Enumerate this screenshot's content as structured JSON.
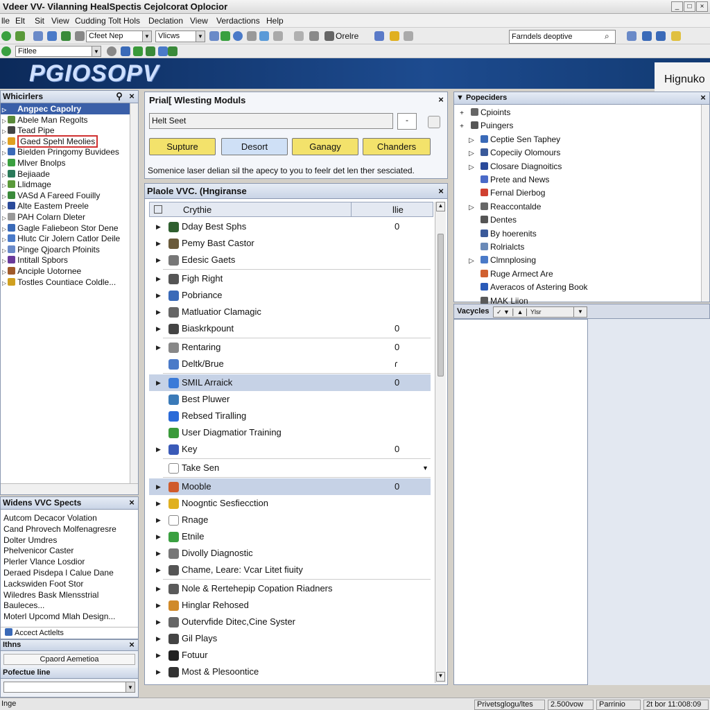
{
  "window": {
    "title": "Vdeer VV- Vilanning HealSpectis Cejolcorat Oplocior"
  },
  "menu": [
    "lle",
    "Elt",
    "Sit",
    "View",
    "Cudding",
    "Tolt Hols",
    "Declation",
    "View",
    "Verdactions",
    "Help"
  ],
  "toolbar": {
    "combo1": "Cfeet Nep",
    "combo2": "Vlicws",
    "label_orelre": "Orelre",
    "combo3": "Fitlee",
    "search": "Farndels deoptive"
  },
  "banner": {
    "logo": "PGIOSOPV",
    "right_text": "Hignuko"
  },
  "left_panel": {
    "title": "Whicirlers",
    "items": [
      {
        "label": "Angpec Capolry",
        "color": "#3a5fa8",
        "selected": true
      },
      {
        "label": "Abele Man Regolts",
        "color": "#5a8a3a"
      },
      {
        "label": "Tead Pipe",
        "color": "#444"
      },
      {
        "label": "Gaed Spehl Meolies",
        "color": "#e0a020",
        "highlight": true
      },
      {
        "label": "Bielden Pringomy Buvidees",
        "color": "#3a6ab8"
      },
      {
        "label": "Mlver Bnolps",
        "color": "#3aa040"
      },
      {
        "label": "Bejiaade",
        "color": "#2a7a5a"
      },
      {
        "label": "Llidmage",
        "color": "#5a9a3a"
      },
      {
        "label": "VASd A Fareed Fouilly",
        "color": "#3a8a3a"
      },
      {
        "label": "Alte Eastem Preele",
        "color": "#2a4a9a"
      },
      {
        "label": "PAH Colarn Dleter",
        "color": "#999"
      },
      {
        "label": "Gagle Faliebeon Stor Dene",
        "color": "#3a6ab8"
      },
      {
        "label": "Hlutc Cir Jolern Catlor Deile",
        "color": "#4a7ac8"
      },
      {
        "label": "Pinge Qjoarch Pfoinits",
        "color": "#6a8ac8"
      },
      {
        "label": "Intitall Spbors",
        "color": "#6a3a9a"
      },
      {
        "label": "Anciple Uotornee",
        "color": "#a05a2a"
      },
      {
        "label": "Tostles Countiace Coldle...",
        "color": "#d0a020"
      }
    ]
  },
  "left_panel2": {
    "title": "Widens VVC Spects",
    "items": [
      "Autcom Decacor Volation",
      "Cand Phrovech Molfenagresre",
      "Dolter Umdres",
      "Phelvenicor Caster",
      "Plerler Vlance Losdior",
      "Deraed Pisdepa l Calue Dane",
      "Lackswiden Foot Stor",
      "Wiledres Bask Mlensstrial",
      "Bauleces...",
      "Moterl Upcomd Mlah Design..."
    ],
    "footer_item": "Accect Actlelts"
  },
  "left_small": {
    "title": "Ithns",
    "button": "Cpaord Aemetioa",
    "title2": "Pofectue line"
  },
  "modules_panel": {
    "title": "Prial[ Wlesting Moduls",
    "input_value": "Helt Seet",
    "buttons": [
      "Supture",
      "Desort",
      "Ganagy",
      "Chanders"
    ],
    "hint": "Somenice laser delian sil the apecy to you to feelr det len ther sesciated."
  },
  "vvc_panel": {
    "title": "Plaole VVC. (Hngiranse",
    "col_name": "Crythie",
    "col_val": "llie",
    "rows": [
      {
        "label": "Dday Best Sphs",
        "value": "0",
        "arrow": true,
        "color": "#2f5f2f"
      },
      {
        "label": "Pemy Bast Castor",
        "value": "",
        "arrow": true,
        "color": "#6a5a3a"
      },
      {
        "label": "Edesic Gaets",
        "value": "",
        "arrow": true,
        "color": "#777"
      },
      {
        "label": "Figh Right",
        "value": "",
        "arrow": true,
        "color": "#555"
      },
      {
        "label": "Pobriance",
        "value": "",
        "arrow": true,
        "color": "#3a6ab8"
      },
      {
        "label": "Matluatior Clamagic",
        "value": "",
        "arrow": true,
        "color": "#666"
      },
      {
        "label": "Biaskrkpount",
        "value": "0",
        "arrow": true,
        "color": "#444"
      },
      {
        "label": "Rentaring",
        "value": "0",
        "arrow": true,
        "color": "#888"
      },
      {
        "label": "Deltk/Brue",
        "value": "ɾ",
        "arrow": false,
        "color": "#4a7ac8"
      },
      {
        "label": "SMIL Arraick",
        "value": "0",
        "arrow": true,
        "color": "#3a7ad8",
        "selected": true
      },
      {
        "label": "Best Pluwer",
        "value": "",
        "arrow": false,
        "color": "#3a7ab8"
      },
      {
        "label": "Rebsed Tiralling",
        "value": "",
        "arrow": false,
        "color": "#2a6ad8"
      },
      {
        "label": "User Diagmatior Training",
        "value": "",
        "arrow": false,
        "color": "#3a9a3a"
      },
      {
        "label": "Key",
        "value": "0",
        "arrow": true,
        "color": "#3a5ab8"
      },
      {
        "label": "Take Sen",
        "value": "",
        "arrow": false,
        "color": "#fff",
        "dropdown": true
      },
      {
        "label": "Mooble",
        "value": "0",
        "arrow": true,
        "color": "#d05a2a",
        "selected": true
      },
      {
        "label": "Noogntic Sesfiecction",
        "value": "",
        "arrow": true,
        "color": "#e0b020"
      },
      {
        "label": "Rnage",
        "value": "",
        "arrow": true,
        "color": "#fff"
      },
      {
        "label": "Etnile",
        "value": "",
        "arrow": true,
        "color": "#3aa040"
      },
      {
        "label": "Divolly Diagnostic",
        "value": "",
        "arrow": true,
        "color": "#777"
      },
      {
        "label": "Chame, Leare: Vcar Litet fiuity",
        "value": "",
        "arrow": true,
        "color": "#555"
      },
      {
        "label": "Nole & Rertehepip Copation Riadners",
        "value": "",
        "arrow": true,
        "color": "#5a5a5a"
      },
      {
        "label": "Hinglar Rehosed",
        "value": "",
        "arrow": true,
        "color": "#d08a2a"
      },
      {
        "label": "Outervfide Ditec,Cine Syster",
        "value": "",
        "arrow": true,
        "color": "#666"
      },
      {
        "label": "Gil Plays",
        "value": "",
        "arrow": true,
        "color": "#444"
      },
      {
        "label": "Fotuur",
        "value": "",
        "arrow": true,
        "color": "#222"
      },
      {
        "label": "Most & Plesoontice",
        "value": "",
        "arrow": true,
        "color": "#333"
      }
    ]
  },
  "right_panel": {
    "title": "Popeciders",
    "items": [
      {
        "label": "Cpioints",
        "exp": "+",
        "color": "#666"
      },
      {
        "label": "Puingers",
        "exp": "+",
        "color": "#555"
      },
      {
        "label": "Ceptie Sen Taphey",
        "exp": "▷",
        "color": "#3a6ab8"
      },
      {
        "label": "Copeciiy Olomours",
        "exp": "▷",
        "color": "#3a5a9a"
      },
      {
        "label": "Closare Diagnoitics",
        "exp": "▷",
        "color": "#2a4a9a"
      },
      {
        "label": "Prete and News",
        "exp": "",
        "color": "#4a6ac8"
      },
      {
        "label": "Fernal Dierbog",
        "exp": "",
        "color": "#d04030"
      },
      {
        "label": "Reaccontalde",
        "exp": "▷",
        "color": "#666"
      },
      {
        "label": "Dentes",
        "exp": "",
        "color": "#555"
      },
      {
        "label": "By hoerenits",
        "exp": "",
        "color": "#3a5a9a"
      },
      {
        "label": "Rolrialcts",
        "exp": "",
        "color": "#6a8ab8"
      },
      {
        "label": "Clmnplosing",
        "exp": "▷",
        "color": "#4a7ac8"
      },
      {
        "label": "Ruge Armect Are",
        "exp": "",
        "color": "#d06030"
      },
      {
        "label": "Averacos of Astering Book",
        "exp": "",
        "color": "#2a5ab8"
      },
      {
        "label": "MAK Liion",
        "exp": "",
        "color": "#5a5a5a"
      }
    ],
    "subtoolbar": {
      "label": "Vacycles",
      "field": "Ylsr"
    }
  },
  "statusbar": {
    "left": "Inge",
    "cells": [
      "Privetsglogu/ltes",
      "2.500vow",
      "Parrinio",
      "2t bor 11:008:09"
    ]
  }
}
